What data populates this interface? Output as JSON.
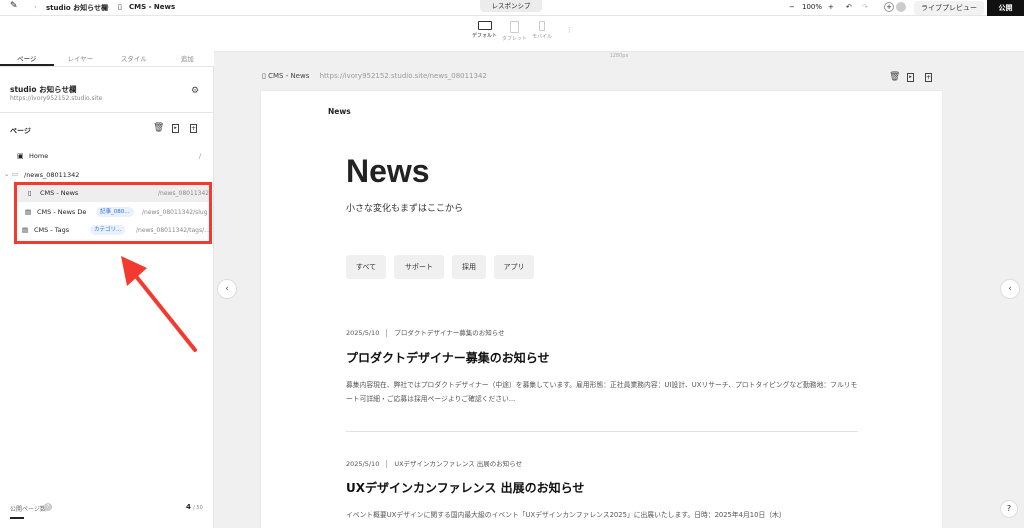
{
  "topbar": {
    "breadcrumb_site": "studio お知らせ欄",
    "breadcrumb_page": "CMS - News",
    "responsive_label": "レスポンシブ",
    "zoom": "100%",
    "preview_label": "ライブプレビュー",
    "publish_label": "公開"
  },
  "devices": {
    "default_label": "デフォルト",
    "tablet_label": "タブレット",
    "mobile_label": "モバイル",
    "width_label": "1280px"
  },
  "sidebar": {
    "tabs": [
      "ページ",
      "レイヤー",
      "スタイル",
      "追加"
    ],
    "site_title": "studio お知らせ欄",
    "site_url": "https://ivory952152.studio.site",
    "page_heading": "ページ",
    "home": {
      "label": "Home",
      "path": "/"
    },
    "folder": {
      "label": "/news_08011342"
    },
    "items": [
      {
        "label": "CMS - News",
        "path": "/news_08011342",
        "badge": ""
      },
      {
        "label": "CMS - News De",
        "path": "/news_08011342/slug",
        "badge": "記事_080..."
      },
      {
        "label": "CMS - Tags",
        "path": "/news_08011342/tags/...",
        "badge": "カテゴリ..."
      }
    ],
    "footer_label": "公開ページ数",
    "footer_count": "4",
    "footer_total": "/ 50"
  },
  "canvas": {
    "page_name": "CMS - News",
    "page_url": "https://ivory952152.studio.site/news_08011342",
    "nav_title": "News",
    "heading": "News",
    "subtitle": "小さな変化もまずはここから",
    "filters": [
      "すべて",
      "サポート",
      "採用",
      "アプリ"
    ],
    "articles": [
      {
        "date": "2025/5/10",
        "category": "プロダクトデザイナー募集のお知らせ",
        "title": "プロダクトデザイナー募集のお知らせ",
        "body": "募集内容現在、弊社ではプロダクトデザイナー（中途）を募集しています。雇用形態：正社員業務内容：UI設計、UXリサーチ、プロトタイピングなど勤務地：フルリモート可詳細・ご応募は採用ページよりご確認ください..."
      },
      {
        "date": "2025/5/10",
        "category": "UXデザインカンファレンス 出展のお知らせ",
        "title": "UXデザインカンファレンス 出展のお知らせ",
        "body": "イベント概要UXデザインに関する国内最大級のイベント「UXデザインカンファレンス2025」に出展いたします。日時：2025年4月10日（木）"
      }
    ]
  },
  "colors": {
    "highlight": "#f23a2f",
    "accent": "#2d6cdf"
  }
}
